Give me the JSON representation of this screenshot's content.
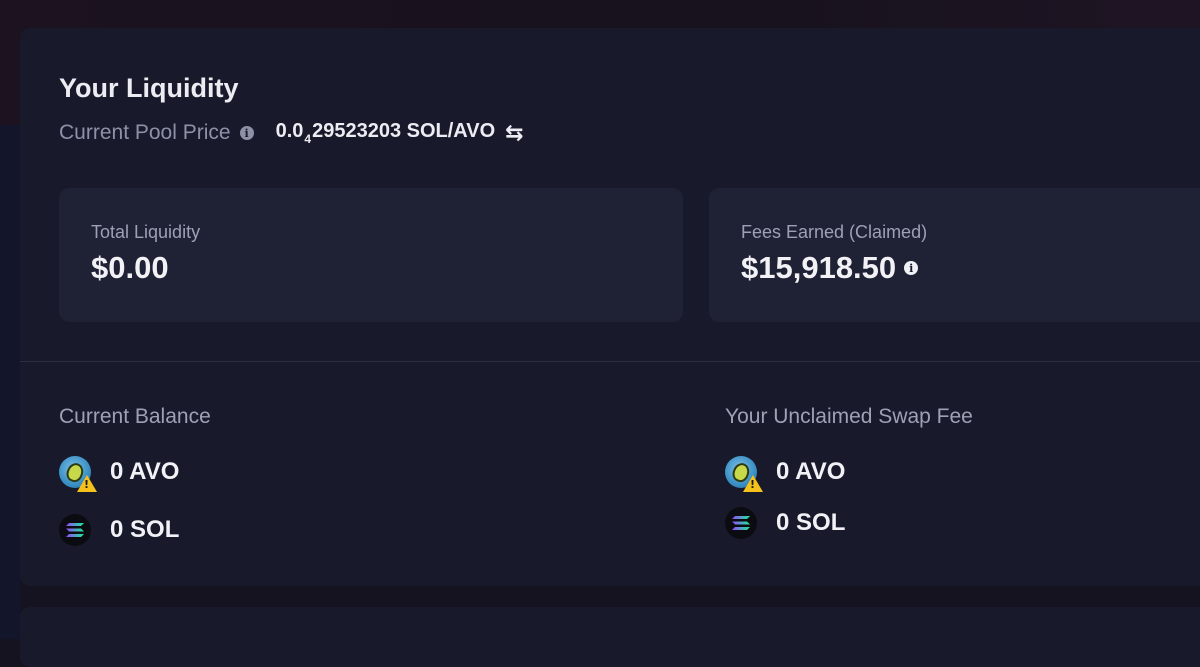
{
  "liquidity": {
    "title": "Your Liquidity",
    "pool_price_label": "Current Pool Price",
    "pool_price_prefix": "0.0",
    "pool_price_zero_count": "4",
    "pool_price_digits": "29523203",
    "pool_price_pair": "SOL/AVO"
  },
  "stats": {
    "total_liquidity_label": "Total Liquidity",
    "total_liquidity_value": "$0.00",
    "fees_earned_label": "Fees Earned (Claimed)",
    "fees_earned_value": "$15,918.50"
  },
  "current_balance": {
    "title": "Current Balance",
    "tokens": [
      {
        "amount": "0",
        "symbol": "AVO",
        "icon": "avo-token-icon"
      },
      {
        "amount": "0",
        "symbol": "SOL",
        "icon": "sol-token-icon"
      }
    ]
  },
  "unclaimed_fee": {
    "title": "Your Unclaimed Swap Fee",
    "tokens": [
      {
        "amount": "0",
        "symbol": "AVO",
        "icon": "avo-token-icon"
      },
      {
        "amount": "0",
        "symbol": "SOL",
        "icon": "sol-token-icon"
      }
    ]
  },
  "colors": {
    "background": "#14131f",
    "card": "#181a2b",
    "stat_box": "#1f2134",
    "muted_text": "#9ea0b6",
    "primary_text": "#f1f1f6",
    "warning": "#f4c21b"
  }
}
